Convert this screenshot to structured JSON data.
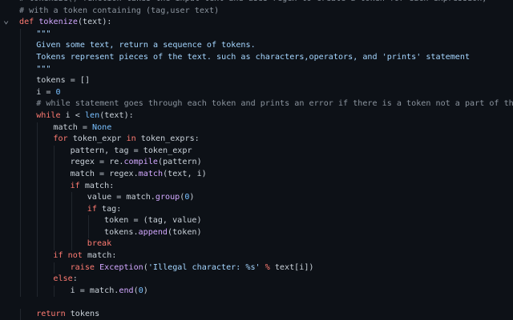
{
  "editor": {
    "language": "python",
    "fold_icon": "chevron-down-icon",
    "colors": {
      "background": "#0d1117",
      "text": "#c9d1d9",
      "comment": "#8b949e",
      "keyword": "#ff7b72",
      "function": "#d2a8ff",
      "string": "#a5d6ff",
      "number": "#79c0ff"
    },
    "lines": [
      {
        "indent": 0,
        "tokens": [
          [
            "c",
            "# tokenize() function takes the input text and uses regex to create a token for each expression,"
          ]
        ]
      },
      {
        "indent": 0,
        "tokens": [
          [
            "c",
            "# with a token containing (tag,user text)"
          ]
        ]
      },
      {
        "indent": 0,
        "fold": true,
        "tokens": [
          [
            "k",
            "def "
          ],
          [
            "f",
            "tokenize"
          ],
          [
            "p",
            "(text):"
          ]
        ]
      },
      {
        "indent": 1,
        "tokens": [
          [
            "s",
            "\"\"\""
          ]
        ]
      },
      {
        "indent": 1,
        "tokens": [
          [
            "s",
            "Given some text, return a sequence of tokens."
          ]
        ]
      },
      {
        "indent": 1,
        "tokens": [
          [
            "s",
            "Tokens represent pieces of the text. such as characters,operators, and 'prints' statement"
          ]
        ]
      },
      {
        "indent": 1,
        "tokens": [
          [
            "s",
            "\"\"\""
          ]
        ]
      },
      {
        "indent": 1,
        "tokens": [
          [
            "p",
            "tokens = []"
          ]
        ]
      },
      {
        "indent": 1,
        "tokens": [
          [
            "p",
            "i = "
          ],
          [
            "n",
            "0"
          ]
        ]
      },
      {
        "indent": 1,
        "tokens": [
          [
            "c",
            "# while statement goes through each token and prints an error if there is a token not a part of the language"
          ]
        ]
      },
      {
        "indent": 1,
        "tokens": [
          [
            "k",
            "while "
          ],
          [
            "p",
            "i < "
          ],
          [
            "b",
            "len"
          ],
          [
            "p",
            "(text):"
          ]
        ]
      },
      {
        "indent": 2,
        "tokens": [
          [
            "p",
            "match = "
          ],
          [
            "n",
            "None"
          ]
        ]
      },
      {
        "indent": 2,
        "tokens": [
          [
            "k",
            "for "
          ],
          [
            "p",
            "token_expr "
          ],
          [
            "k",
            "in "
          ],
          [
            "p",
            "token_exprs:"
          ]
        ]
      },
      {
        "indent": 3,
        "tokens": [
          [
            "p",
            "pattern, tag = token_expr"
          ]
        ]
      },
      {
        "indent": 3,
        "tokens": [
          [
            "p",
            "regex = re."
          ],
          [
            "f",
            "compile"
          ],
          [
            "p",
            "(pattern)"
          ]
        ]
      },
      {
        "indent": 3,
        "tokens": [
          [
            "p",
            "match = regex."
          ],
          [
            "f",
            "match"
          ],
          [
            "p",
            "(text, i)"
          ]
        ]
      },
      {
        "indent": 3,
        "tokens": [
          [
            "k",
            "if "
          ],
          [
            "p",
            "match:"
          ]
        ]
      },
      {
        "indent": 4,
        "tokens": [
          [
            "p",
            "value = match."
          ],
          [
            "f",
            "group"
          ],
          [
            "p",
            "("
          ],
          [
            "n",
            "0"
          ],
          [
            "p",
            ")"
          ]
        ]
      },
      {
        "indent": 4,
        "tokens": [
          [
            "k",
            "if "
          ],
          [
            "p",
            "tag:"
          ]
        ]
      },
      {
        "indent": 5,
        "tokens": [
          [
            "p",
            "token = (tag, value)"
          ]
        ]
      },
      {
        "indent": 5,
        "tokens": [
          [
            "p",
            "tokens."
          ],
          [
            "f",
            "append"
          ],
          [
            "p",
            "(token)"
          ]
        ]
      },
      {
        "indent": 4,
        "tokens": [
          [
            "k",
            "break"
          ]
        ]
      },
      {
        "indent": 2,
        "tokens": [
          [
            "k",
            "if not "
          ],
          [
            "p",
            "match:"
          ]
        ]
      },
      {
        "indent": 3,
        "tokens": [
          [
            "k",
            "raise "
          ],
          [
            "f",
            "Exception"
          ],
          [
            "p",
            "("
          ],
          [
            "s",
            "'Illegal character: %s'"
          ],
          [
            "p",
            " "
          ],
          [
            "k",
            "%"
          ],
          [
            "p",
            " text[i])"
          ]
        ]
      },
      {
        "indent": 2,
        "tokens": [
          [
            "k",
            "else"
          ],
          [
            "p",
            ":"
          ]
        ]
      },
      {
        "indent": 3,
        "tokens": [
          [
            "p",
            "i = match."
          ],
          [
            "f",
            "end"
          ],
          [
            "p",
            "("
          ],
          [
            "n",
            "0"
          ],
          [
            "p",
            ")"
          ]
        ]
      },
      {
        "indent": 0,
        "tokens": []
      },
      {
        "indent": 1,
        "tokens": [
          [
            "k",
            "return "
          ],
          [
            "p",
            "tokens"
          ]
        ]
      }
    ]
  }
}
